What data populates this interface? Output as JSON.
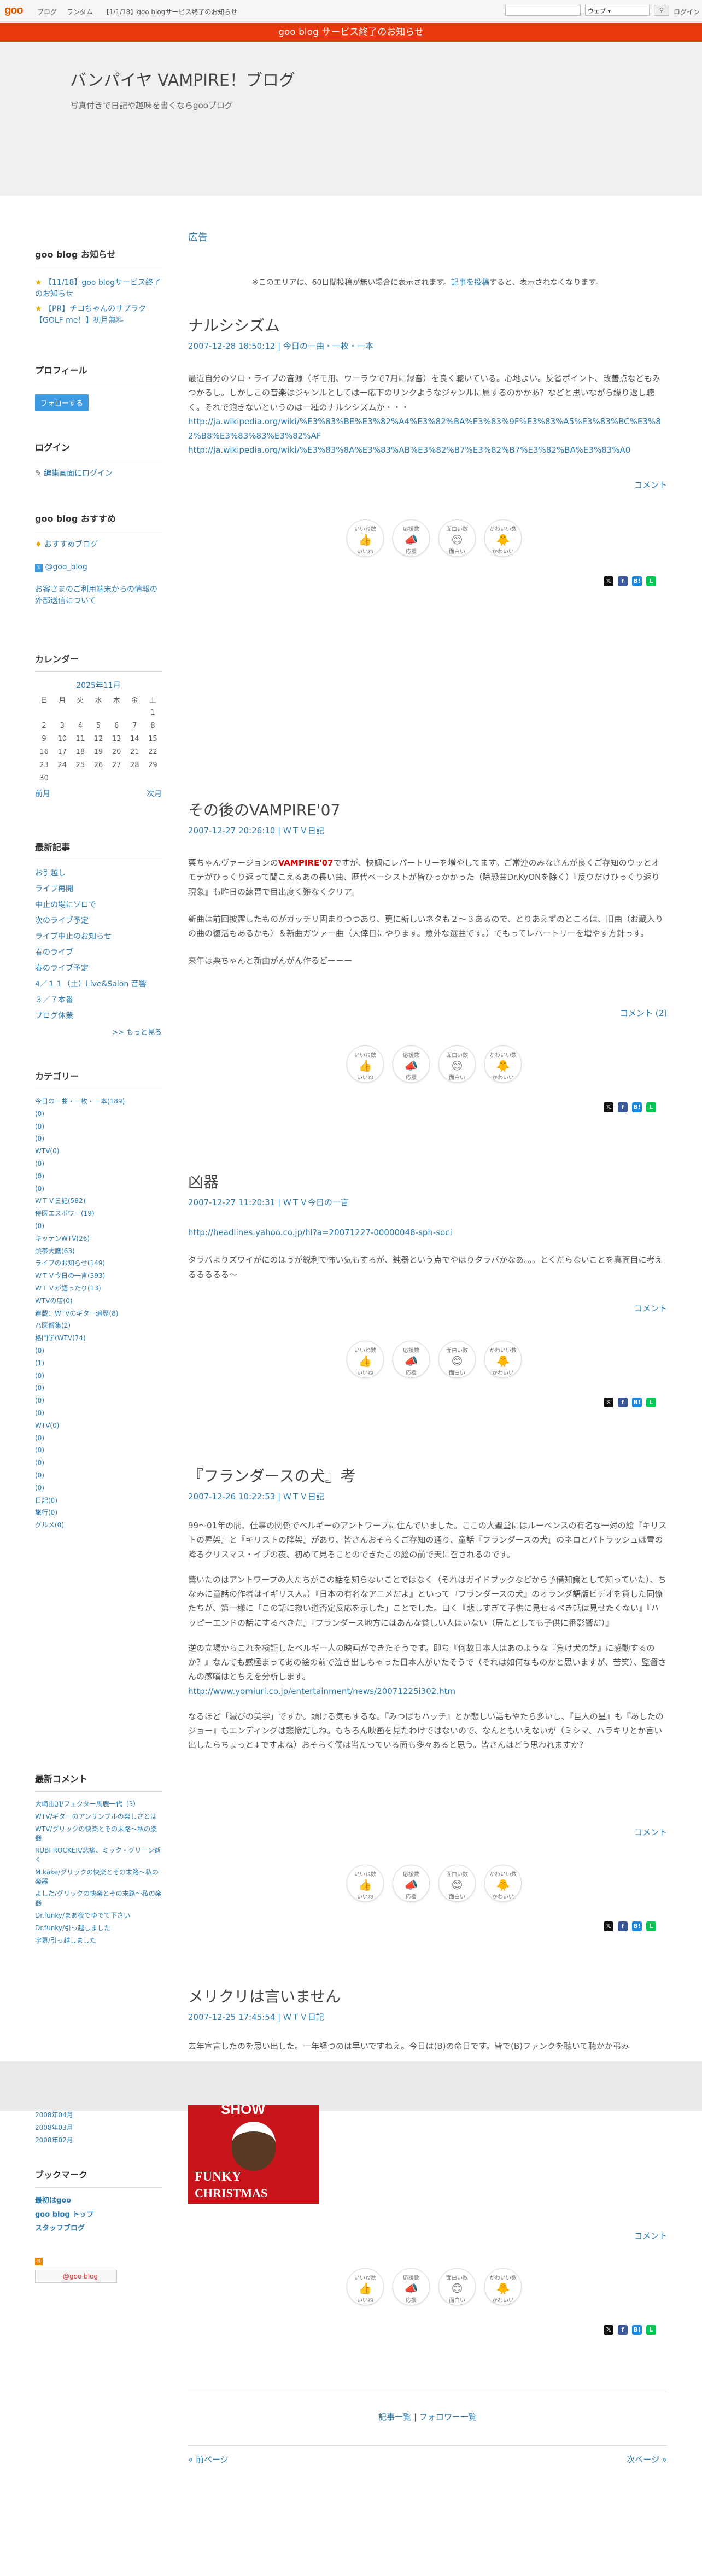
{
  "topbar": {
    "logo": "goo",
    "links": [
      "ブログ",
      "ランダム",
      "【1/1/18】goo blogサービス終了のお知らせ"
    ],
    "search_select": "ウェブ",
    "search_icon": "search-icon",
    "login": "ログイン"
  },
  "notice": "goo blog サービス終了のお知らせ",
  "blog": {
    "title": "バンパイヤ VAMPIRE！ブログ",
    "subtitle": "写真付きで日記や趣味を書くならgooブログ"
  },
  "sidebar": {
    "news_title": "goo blog お知らせ",
    "news": [
      "【11/18】goo blogサービス終了のお知らせ",
      "【PR】チコちゃんのサプラク【GOLF me！】初月無料"
    ],
    "profile_title": "プロフィール",
    "follow": "フォローする",
    "login_title": "ログイン",
    "login_link": "編集画面にログイン",
    "rec_title": "goo blog おすすめ",
    "rec": [
      "おすすめブログ",
      "@goo_blog",
      "お客さまのご利用端末からの情報の外部送信について"
    ],
    "cal_title": "カレンダー",
    "cal_month": "2025年11月",
    "cal_head": [
      "日",
      "月",
      "火",
      "水",
      "木",
      "金",
      "土"
    ],
    "cal_rows": [
      [
        "",
        "",
        "",
        "",
        "",
        "",
        "1"
      ],
      [
        "2",
        "3",
        "4",
        "5",
        "6",
        "7",
        "8"
      ],
      [
        "9",
        "10",
        "11",
        "12",
        "13",
        "14",
        "15"
      ],
      [
        "16",
        "17",
        "18",
        "19",
        "20",
        "21",
        "22"
      ],
      [
        "23",
        "24",
        "25",
        "26",
        "27",
        "28",
        "29"
      ],
      [
        "30",
        "",
        "",
        "",
        "",
        "",
        ""
      ]
    ],
    "cal_prev": "前月",
    "cal_next": "次月",
    "recent_title": "最新記事",
    "recent": [
      "お引越し",
      "ライブ再開",
      "中止の場にソロで",
      "次のライブ予定",
      "ライブ中止のお知らせ",
      "春のライブ",
      "春のライブ予定",
      "4／１１（土）Live&Salon 音響",
      "３／７本番",
      "ブログ休業"
    ],
    "recent_more": ">> もっと見る",
    "cat_title": "カテゴリー",
    "cats": [
      "今日の一曲・一枚・一本(189)",
      "(0)",
      "(0)",
      "(0)",
      "WTV(0)",
      "(0)",
      "(0)",
      "(0)",
      "ＷＴＶ日記(582)",
      "侍医エスポワー(19)",
      "(0)",
      "キッテンWTV(26)",
      "熱帯大鷹(63)",
      "ライブのお知らせ(149)",
      "ＷＴＶ今日の一言(393)",
      "ＷＴＶが語ったり(13)",
      "WTVの店(0)",
      "連載：WTVのギター遍歴(8)",
      "ハ医僧集(2)",
      "格門学(WTV(74)",
      "(0)",
      "(1)",
      "(0)",
      "(0)",
      "(0)",
      "(0)",
      "WTV(0)",
      "(0)",
      "(0)",
      "(0)",
      "(0)",
      "(0)",
      "日記(0)",
      "旅行(0)",
      "グルメ(0)"
    ],
    "comments_title": "最新コメント",
    "comments": [
      "大崎由加/フェクター馬鹿一代（3）",
      "WTV/ギターのアンサンブルの楽しさとは",
      "WTV/グリックの快楽とその末路～私の楽器",
      "RUBI ROCKER/悲痛、ミック・グリーン逝く",
      "M.kake/グリックの快楽とその末路～私の楽器",
      "よしだ/グリックの快楽とその末路～私の楽器",
      "Dr.funky/まあ夜でゆでて下さい",
      "Dr.funky/引っ越しました",
      "字幕/引っ越しました"
    ],
    "archive": [
      "2008年04月",
      "2008年03月",
      "2008年02月"
    ],
    "bm_title": "ブックマーク",
    "bm": [
      "最初はgoo",
      "goo blog トップ",
      "スタッフブログ"
    ],
    "rss": "RSS",
    "badge": "@goo blog"
  },
  "ad": {
    "heading": "広告",
    "text": "※このエリアは、60日間投稿が無い場合に表示されます。",
    "link": "記事を投稿",
    "text2": "すると、表示されなくなります。"
  },
  "reactions": [
    "いいね",
    "応援",
    "面白い",
    "かわいい"
  ],
  "reaction_subs": [
    "いいね数",
    "応援数",
    "面白い数",
    "かわいい数"
  ],
  "share_icons": [
    "x-icon",
    "facebook-icon",
    "hatena-icon",
    "line-icon"
  ],
  "posts": [
    {
      "title": "ナルシシズム",
      "date": "2007-12-28 18:50:12",
      "cat": "今日の一曲・一枚・一本",
      "body": "最近自分のソロ・ライブの音源（ギモ用、ウーラウで7月に録音）を良く聴いている。心地よい。反省ポイント、改善点などもみつかるし。しかしこの音楽はジャンルとしては一応下のリンクようなジャンルに属するのかかあ？などと思いながら繰り返し聴く。それで飽きないというのは一種のナルシシズムか・・・",
      "link1": "http://ja.wikipedia.org/wiki/%E3%83%BE%E3%82%A4%E3%82%BA%E3%83%9F%E3%83%A5%E3%83%BC%E3%82%B8%E3%83%83%E3%82%AF",
      "link2": "http://ja.wikipedia.org/wiki/%E3%83%8A%E3%83%AB%E3%82%B7%E3%82%B7%E3%82%BA%E3%83%A0",
      "comment": "コメント"
    },
    {
      "title": "その後のVAMPIRE'07",
      "date": "2007-12-27 20:26:10",
      "cat": "ＷＴＶ日記",
      "body_pre": "栗ちゃんヴァージョンの",
      "body_red": "VAMPIRE'07",
      "body_post": "ですが、快調にレパートリーを増やしてます。ご常連のみなさんが良くご存知のウッとオモテがひっくり返って聞こえるあの長い曲、歴代ベーシストが皆ひっかかった（除恐曲Dr.KyONを除く）『反ウだけひっくり返り現象』も昨日の練習で目出度く難なくクリア。",
      "body2": "新曲は前回披露したものがガッチリ固まりつつあり、更に新しいネタも２～３あるので、とりあえずのところは、旧曲（お蔵入りの曲の復活もあるかも）＆新曲ガツァー曲（大倖日にやります。意外な選曲です。）でもってレパートリーを増やす方針っす。",
      "body3": "来年は栗ちゃんと新曲がんがん作るどーーー",
      "comment": "コメント (2)"
    },
    {
      "title": "凶器",
      "date": "2007-12-27 11:20:31",
      "cat": "ＷＴＶ今日の一言",
      "link": "http://headlines.yahoo.co.jp/hl?a=20071227-00000048-sph-soci",
      "body": "タラバよりズワイがにのほうが鋭利で怖い気もするが、鈍器という点でやはりタラバかなあ。。。とくだらないことを真面目に考えるるるるる～",
      "comment": "コメント"
    },
    {
      "title": "『フランダースの犬』考",
      "date": "2007-12-26 10:22:53",
      "cat": "ＷＴＶ日記",
      "body": "99～01年の間、仕事の関係でベルギーのアントワープに住んでいました。ここの大聖堂にはルーベンスの有名な一対の絵『キリストの昇架』と『キリストの降架』があり、皆さんおそらくご存知の通り、童話『フランダースの犬』のネロとパトラッシュは雪の降るクリスマス・イブの夜、初めて見ることのできたこの絵の前で天に召されるのです。",
      "body2": "驚いたのはアントワープの人たちがこの話を知らないことではなく（それはガイドブックなどから予備知識として知っていた）、ちなみに童話の作者はイギリス人。）『日本の有名なアニメだよ』といって『フランダースの犬』のオランダ語版ビデオを貸した同僚たちが、第一様に「この話に救い道否定反応を示した」ことでした。曰く『悲しすぎて子供に見せるべき話は見せたくない』『ハッピーエンドの話にするべきだ』『フランダース地方にはあんな貧しい人はいない（居たとしても子供に番影響だ）』",
      "body3": "逆の立場からこれを検証したベルギー人の映画ができたそうです。即ち『何故日本人はあのような『負け犬の話』に感動するのか？』なんでも感極まってあの絵の前で泣き出しちゃった日本人がいたそうで（それは如何なものかと思いますが、苦笑）、監督さんの感嘆はとちえを分析します。",
      "link": "http://www.yomiuri.co.jp/entertainment/news/20071225i302.htm",
      "body4": "なるほど「滅びの美学」ですか。頭ける気もするな。『みつばちハッチ』とか悲しい話もやたら多いし、『巨人の星』も『あしたのジョー』もエンディングは悲惨だしね。もちろん映画を見たわけではないので、なんともいえないが（ミシマ、ハラキリとか言い出したらちょっと↓ですよね）おそらく僕は当たっている面も多々あると思う。皆さんはどう思われますか？",
      "comment": "コメント"
    },
    {
      "title": "メリクリは言いません",
      "date": "2007-12-25 17:45:54",
      "cat": "ＷＴＶ日記",
      "body": "去年宣言したのを思い出した。一年経つのは早いですねえ。今日は(B)の命日です。皆で(B)ファンクを聴いて聴かか弔み",
      "img_top": "SHOW",
      "img_line1": "FUNKY",
      "img_line2": "CHRISTMAS",
      "comment": "コメント"
    }
  ],
  "footer": {
    "list": "記事一覧",
    "sep": "|",
    "follow_list": "フォロワー一覧",
    "prev": "« 前ページ",
    "next": "次ページ »"
  }
}
